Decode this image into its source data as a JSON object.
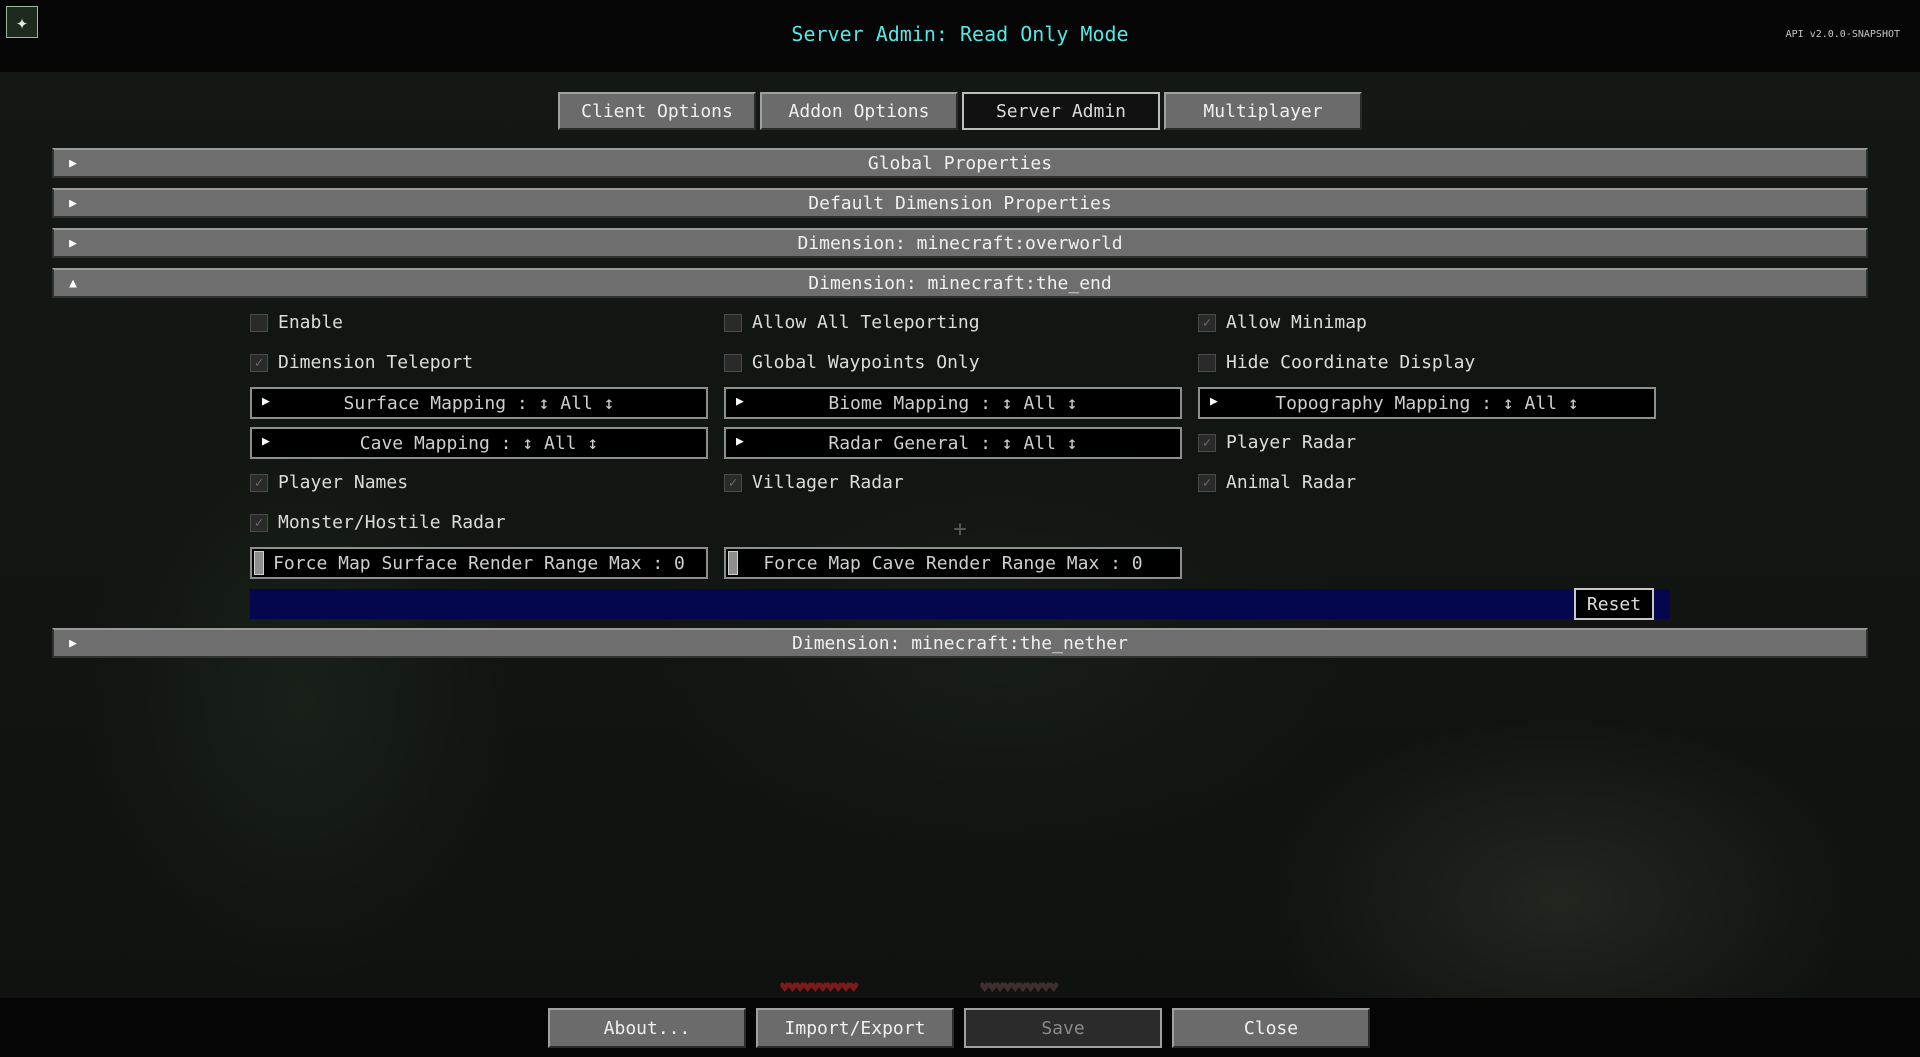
{
  "header": {
    "title": "Server Admin: Read Only Mode",
    "api_version": "API v2.0.0-SNAPSHOT",
    "icon": "app-icon"
  },
  "tabs": [
    {
      "label": "Client Options",
      "active": false
    },
    {
      "label": "Addon Options",
      "active": false
    },
    {
      "label": "Server Admin",
      "active": true
    },
    {
      "label": "Multiplayer",
      "active": false
    }
  ],
  "sections": {
    "global": {
      "label": "Global Properties",
      "expanded": false
    },
    "default_dimension": {
      "label": "Default Dimension Properties",
      "expanded": false
    },
    "overworld": {
      "label": "Dimension: minecraft:overworld",
      "expanded": false
    },
    "the_end": {
      "label": "Dimension: minecraft:the_end",
      "expanded": true
    },
    "the_nether": {
      "label": "Dimension: minecraft:the_nether",
      "expanded": false
    }
  },
  "end_options": {
    "enable": {
      "label": "Enable",
      "checked": false
    },
    "allow_all_teleporting": {
      "label": "Allow All Teleporting",
      "checked": false
    },
    "allow_minimap": {
      "label": "Allow Minimap",
      "checked": true
    },
    "dimension_teleport": {
      "label": "Dimension Teleport",
      "checked": true
    },
    "global_waypoints_only": {
      "label": "Global Waypoints Only",
      "checked": false
    },
    "hide_coordinate_display": {
      "label": "Hide Coordinate Display",
      "checked": false
    },
    "surface_mapping": "Surface Mapping : ↕ All ↕",
    "biome_mapping": "Biome Mapping : ↕ All ↕",
    "topography_mapping": "Topography Mapping : ↕ All ↕",
    "cave_mapping": "Cave Mapping : ↕ All ↕",
    "radar_general": "Radar General : ↕ All ↕",
    "player_radar": {
      "label": "Player Radar",
      "checked": true
    },
    "player_names": {
      "label": "Player Names",
      "checked": true
    },
    "villager_radar": {
      "label": "Villager Radar",
      "checked": true
    },
    "animal_radar": {
      "label": "Animal Radar",
      "checked": true
    },
    "monster_radar": {
      "label": "Monster/Hostile Radar",
      "checked": true
    },
    "force_surface_range": {
      "label": "Force Map Surface Render Range Max : 0",
      "value": 0
    },
    "force_cave_range": {
      "label": "Force Map Cave Render Range Max : 0",
      "value": 0
    },
    "reset_label": "Reset"
  },
  "check_glyph": "✓",
  "hud": {
    "hearts": "♥♥♥♥♥♥♥♥♥♥",
    "armor": "♥♥♥♥♥♥♥♥♥♥"
  },
  "footer": {
    "about": "About...",
    "import_export": "Import/Export",
    "save": "Save",
    "close": "Close"
  }
}
